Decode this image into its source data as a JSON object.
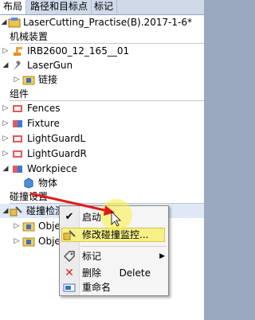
{
  "tabs": [
    "布局",
    "路径和目标点",
    "标记"
  ],
  "tree": {
    "station": "LaserCutting_Practise(B).2017-1-6*",
    "section_mechanisms": "机械装置",
    "robot": "IRB2600_12_165__01",
    "tool": "LaserGun",
    "tool_child": "链接",
    "section_components": "组件",
    "components": [
      "Fences",
      "Fixture",
      "LightGuardL",
      "LightGuardR",
      "Workpiece"
    ],
    "workpiece_child": "物体",
    "section_collision": "碰撞设置",
    "collision_set": "碰撞检测设定_",
    "collision_children": [
      "Obje",
      "Obje"
    ]
  },
  "context_menu": {
    "items": [
      {
        "label": "启动",
        "icon": "checkmark-icon"
      },
      {
        "label": "修改碰撞监控...",
        "icon": "collision-edit-icon"
      },
      {
        "label": "标记",
        "icon": "tag-icon"
      },
      {
        "label": "删除",
        "icon": "delete-x-icon",
        "shortcut": "Delete"
      },
      {
        "label": "重命名",
        "icon": "rename-icon"
      }
    ],
    "highlight_color": "#f5f088"
  },
  "colors": {
    "accent_arrow": "#e01b1b",
    "tab_bar": "#cfd9e8",
    "background": "#9aa9c0"
  }
}
